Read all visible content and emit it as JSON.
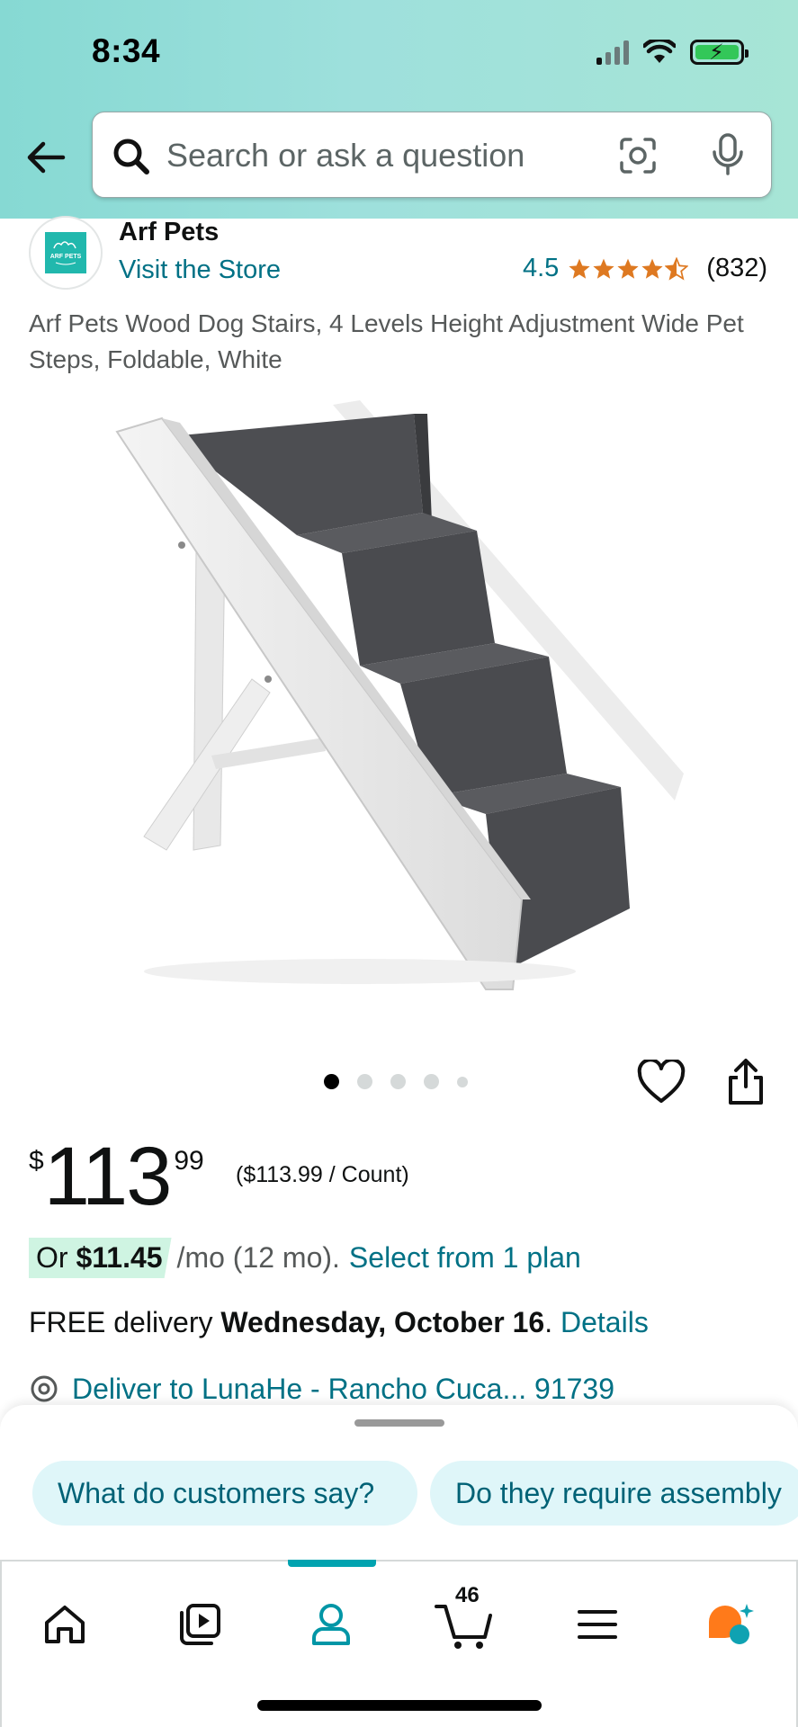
{
  "status_bar": {
    "time": "8:34"
  },
  "search": {
    "placeholder": "Search or ask a question"
  },
  "brand": {
    "logo_text": "ARF PETS",
    "name": "Arf Pets",
    "visit_store": "Visit the Store"
  },
  "rating": {
    "value": "4.5",
    "stars": 4.5,
    "count": "(832)",
    "star_color": "#de7921"
  },
  "product": {
    "title": "Arf Pets Wood Dog Stairs, 4 Levels Height Adjustment Wide Pet Steps, Foldable, White"
  },
  "carousel": {
    "total": 5,
    "active": 0
  },
  "price": {
    "currency": "$",
    "whole": "113",
    "fraction": "99",
    "unit_price": "($113.99 / Count)"
  },
  "finance": {
    "prefix": "Or ",
    "amount": "$11.45",
    "term": " /mo (12 mo).",
    "plan_link": "Select from 1 plan"
  },
  "delivery": {
    "prefix": "FREE delivery ",
    "date": "Wednesday, October 16",
    "suffix": ". ",
    "details": "Details"
  },
  "deliver_to": {
    "text": "Deliver to LunaHe - Rancho Cuca... 91739"
  },
  "suggestions": [
    "What do customers say?",
    "Do they require assembly"
  ],
  "tabbar": {
    "cart_count": "46",
    "active_tab": "account"
  },
  "colors": {
    "link": "#007185",
    "accent": "#00a3b0",
    "finance_pill": "#cff4e2",
    "chip_bg": "#dff6f9"
  }
}
